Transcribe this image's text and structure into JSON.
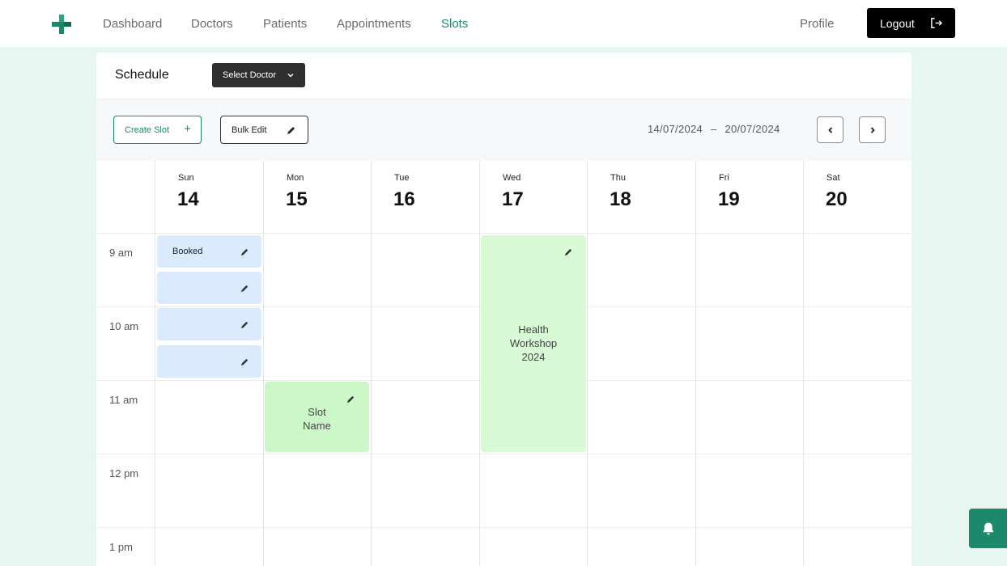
{
  "nav": {
    "logo": "clinic-logo",
    "links": [
      "Dashboard",
      "Doctors",
      "Patients",
      "Appointments",
      "Slots"
    ],
    "active": "Slots",
    "profile": "Profile",
    "logout": "Logout"
  },
  "schedule": {
    "title": "Schedule",
    "select_doctor": "Select Doctor",
    "create_slot": "Create Slot",
    "bulk_edit": "Bulk Edit",
    "date_start": "14/07/2024",
    "date_sep": "–",
    "date_end": "20/07/2024"
  },
  "days": [
    {
      "name": "Sun",
      "num": "14"
    },
    {
      "name": "Mon",
      "num": "15"
    },
    {
      "name": "Tue",
      "num": "16"
    },
    {
      "name": "Wed",
      "num": "17"
    },
    {
      "name": "Thu",
      "num": "18"
    },
    {
      "name": "Fri",
      "num": "19"
    },
    {
      "name": "Sat",
      "num": "20"
    }
  ],
  "times": [
    "9 am",
    "10 am",
    "11 am",
    "12 pm",
    "1 pm"
  ],
  "slots": {
    "booked_label": "Booked",
    "slot_name_line1": "Slot",
    "slot_name_line2": "Name",
    "workshop_line1": "Health",
    "workshop_line2": "Workshop",
    "workshop_line3": "2024"
  },
  "colors": {
    "accent": "#1a8a6a",
    "booked_slot": "#dbeafd",
    "event_slot": "#d8fad4",
    "background": "#e8f6f1"
  }
}
